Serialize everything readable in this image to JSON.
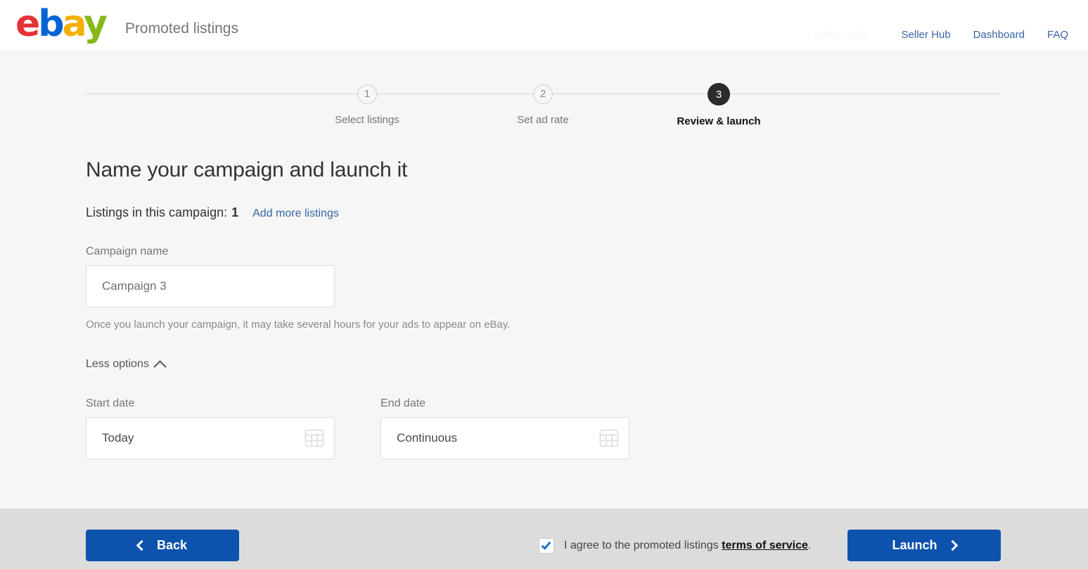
{
  "header": {
    "logo_letters": [
      "e",
      "b",
      "a",
      "y"
    ],
    "logo_colors": {
      "e": "#e53238",
      "b": "#0064d2",
      "a": "#f5af02",
      "y": "#86b817"
    },
    "app_title": "Promoted listings",
    "user_redacted": "seller-name",
    "nav": [
      {
        "label": "Seller Hub"
      },
      {
        "label": "Dashboard"
      },
      {
        "label": "FAQ"
      }
    ]
  },
  "stepper": {
    "steps": [
      {
        "number": "1",
        "label": "Select listings",
        "active": false
      },
      {
        "number": "2",
        "label": "Set ad rate",
        "active": false
      },
      {
        "number": "3",
        "label": "Review & launch",
        "active": true
      }
    ]
  },
  "main": {
    "page_title": "Name your campaign and launch it",
    "listings_label": "Listings in this campaign:",
    "listings_count": "1",
    "add_more_link": "Add more listings",
    "campaign_name": {
      "label": "Campaign name",
      "value": "Campaign 3",
      "placeholder": "Campaign 3"
    },
    "helper_text": "Once you launch your campaign, it may take several hours for your ads to appear on eBay.",
    "options_toggle": {
      "label": "Less options",
      "icon": "chevron-up-icon",
      "expanded": true
    },
    "start_date": {
      "label": "Start date",
      "value": "Today",
      "icon": "calendar-icon"
    },
    "end_date": {
      "label": "End date",
      "value": "Continuous",
      "icon": "calendar-icon"
    }
  },
  "footer": {
    "back_label": "Back",
    "back_icon": "chevron-left-icon",
    "launch_label": "Launch",
    "launch_icon": "chevron-right-icon",
    "agree_prefix": "I agree to the promoted listings",
    "agree_link": "terms of service",
    "agree_suffix": ".",
    "checkbox_checked": true
  },
  "colors": {
    "primary_button": "#0d52ad",
    "link": "#3665a5",
    "page_background": "#f6f6f6",
    "footer_background": "#dcdcdc",
    "active_step": "#2b2b2b"
  }
}
